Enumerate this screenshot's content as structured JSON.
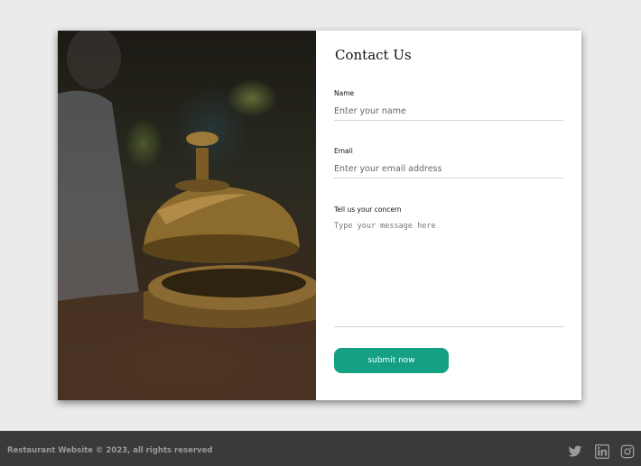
{
  "contact": {
    "title": "Contact Us",
    "name_label": "Name",
    "name_placeholder": "Enter your name",
    "email_label": "Email",
    "email_placeholder": "Enter your email address",
    "concern_label": "Tell us your concern",
    "concern_placeholder": "Type your message here",
    "submit_label": "submit now"
  },
  "footer": {
    "copyright": "Restaurant Website © 2023, all rights reserved",
    "social_icons": [
      "twitter-icon",
      "linkedin-icon",
      "instagram-icon"
    ]
  },
  "colors": {
    "page_background": "#ebebeb",
    "accent": "#15a083",
    "footer_background": "#3a3a3a",
    "footer_text": "#9a9a9a"
  }
}
